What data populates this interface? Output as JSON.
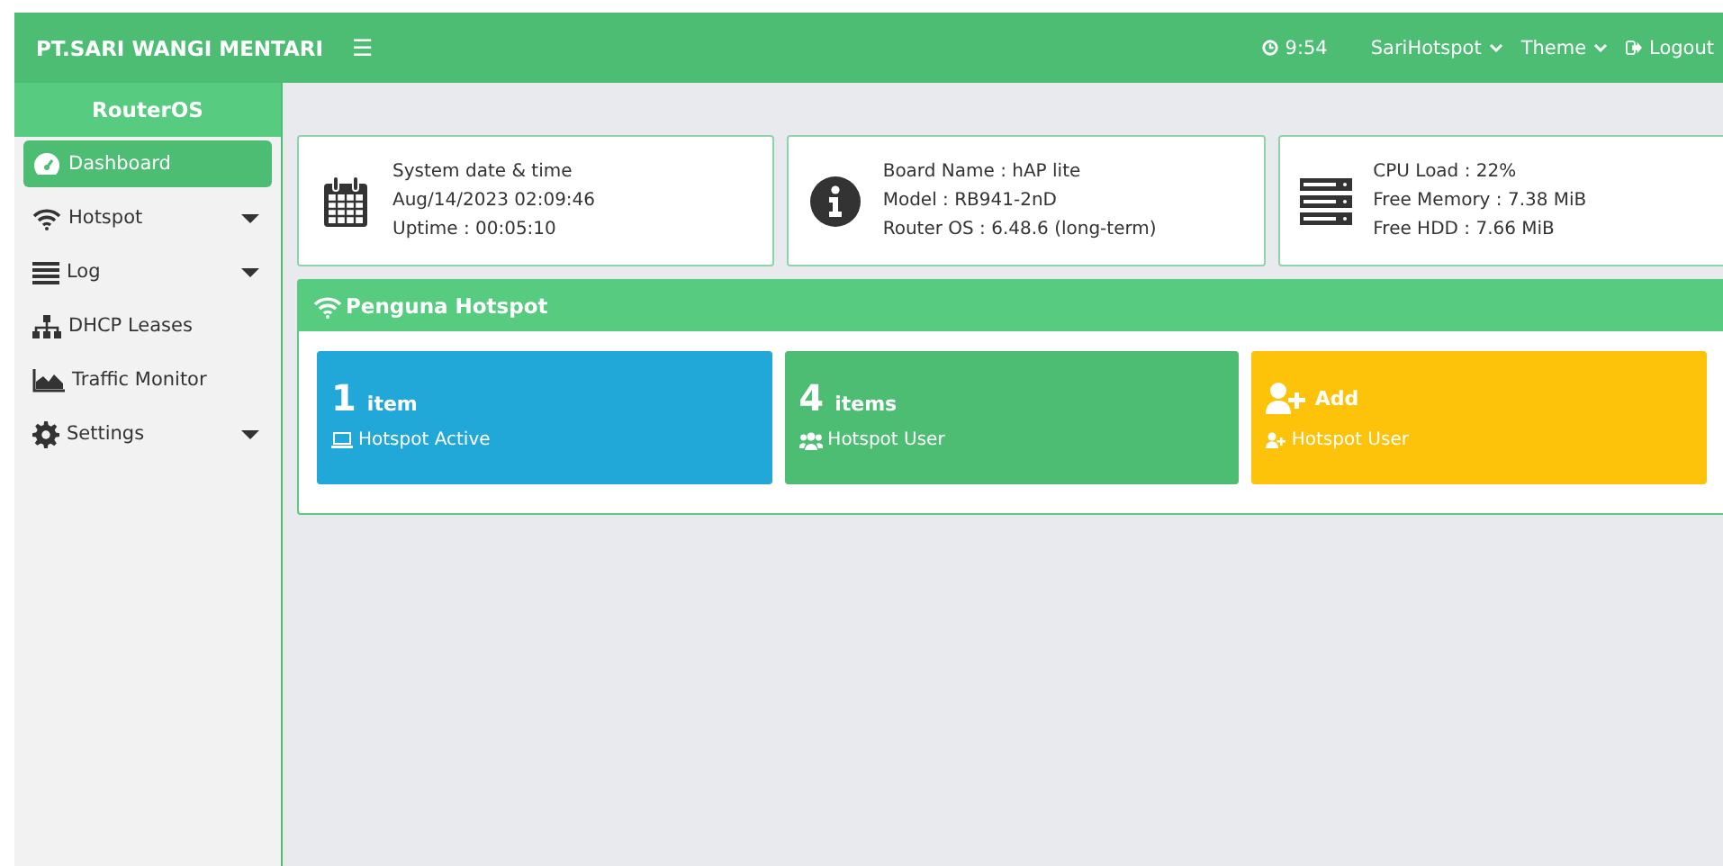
{
  "header": {
    "brand": "PT.SARI WANGI MENTARI",
    "menu_glyph": "☰",
    "clock": "9:54",
    "user_menu": "SariHotspot",
    "theme_menu": "Theme",
    "logout": "Logout"
  },
  "sidebar": {
    "title": "RouterOS",
    "items": [
      {
        "label": "Dashboard",
        "selected": true,
        "expandable": false
      },
      {
        "label": "Hotspot",
        "selected": false,
        "expandable": true
      },
      {
        "label": "Log",
        "selected": false,
        "expandable": true
      },
      {
        "label": "DHCP Leases",
        "selected": false,
        "expandable": false
      },
      {
        "label": "Traffic Monitor",
        "selected": false,
        "expandable": false
      },
      {
        "label": "Settings",
        "selected": false,
        "expandable": true
      }
    ]
  },
  "info_cards": [
    {
      "lines": [
        "System date & time",
        "Aug/14/2023 02:09:46",
        "Uptime : 00:05:10"
      ]
    },
    {
      "lines": [
        "Board Name : hAP lite",
        "Model : RB941-2nD",
        "Router OS : 6.48.6 (long-term)"
      ]
    },
    {
      "lines": [
        "CPU Load : 22%",
        "Free Memory : 7.38 MiB",
        "Free HDD : 7.66 MiB"
      ]
    }
  ],
  "hotspot_panel": {
    "title": "Penguna Hotspot",
    "tiles": [
      {
        "kind": "count",
        "value": "1",
        "unit": "item",
        "label": "Hotspot Active",
        "color": "#22a7d9"
      },
      {
        "kind": "count",
        "value": "4",
        "unit": "items",
        "label": "Hotspot User",
        "color": "#4dbd74"
      },
      {
        "kind": "add",
        "unit": "Add",
        "label": "Hotspot User",
        "color": "#fdc20a"
      }
    ]
  }
}
